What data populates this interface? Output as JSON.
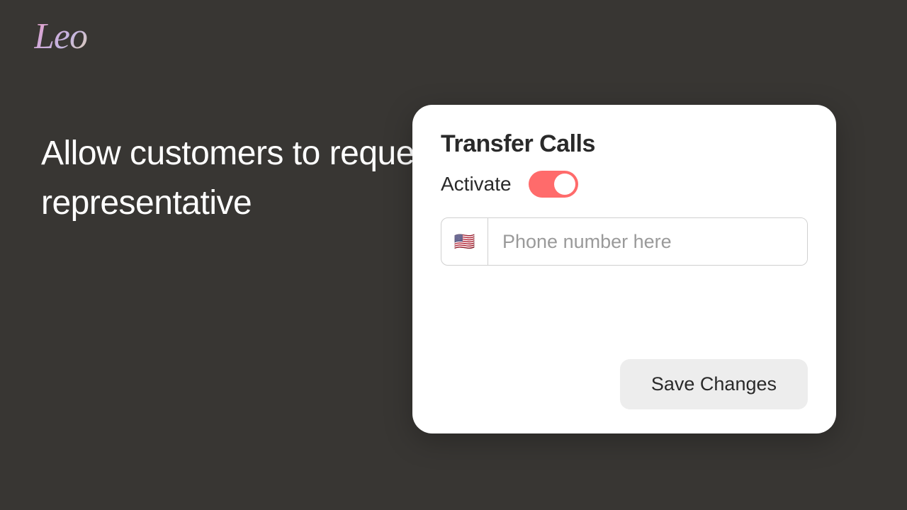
{
  "logo": "Leo",
  "headline": "Allow customers to request transfer to a human representative",
  "card": {
    "title": "Transfer Calls",
    "activate_label": "Activate",
    "toggle_on": true,
    "flag_emoji": "🇺🇸",
    "phone_placeholder": "Phone number here",
    "phone_value": "",
    "save_label": "Save Changes"
  },
  "colors": {
    "toggle_active": "#ff6b6b",
    "background": "#383633"
  }
}
